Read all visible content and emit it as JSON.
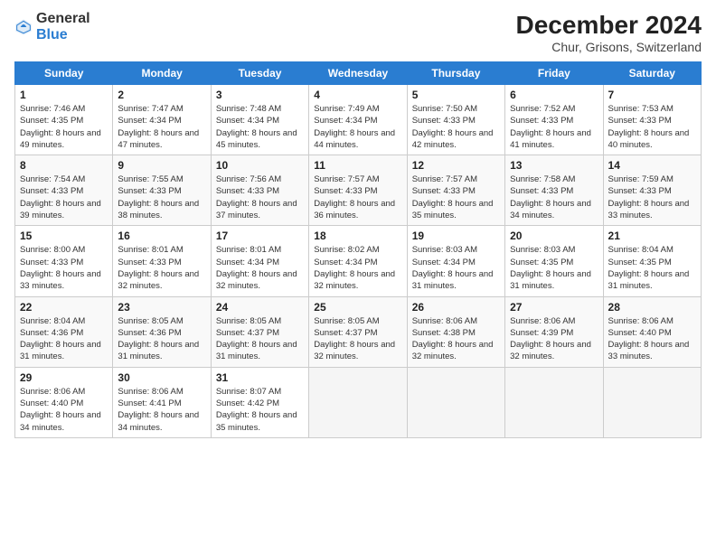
{
  "header": {
    "logo_general": "General",
    "logo_blue": "Blue",
    "main_title": "December 2024",
    "subtitle": "Chur, Grisons, Switzerland"
  },
  "columns": [
    "Sunday",
    "Monday",
    "Tuesday",
    "Wednesday",
    "Thursday",
    "Friday",
    "Saturday"
  ],
  "weeks": [
    [
      {
        "day": "1",
        "sunrise": "Sunrise: 7:46 AM",
        "sunset": "Sunset: 4:35 PM",
        "daylight": "Daylight: 8 hours and 49 minutes."
      },
      {
        "day": "2",
        "sunrise": "Sunrise: 7:47 AM",
        "sunset": "Sunset: 4:34 PM",
        "daylight": "Daylight: 8 hours and 47 minutes."
      },
      {
        "day": "3",
        "sunrise": "Sunrise: 7:48 AM",
        "sunset": "Sunset: 4:34 PM",
        "daylight": "Daylight: 8 hours and 45 minutes."
      },
      {
        "day": "4",
        "sunrise": "Sunrise: 7:49 AM",
        "sunset": "Sunset: 4:34 PM",
        "daylight": "Daylight: 8 hours and 44 minutes."
      },
      {
        "day": "5",
        "sunrise": "Sunrise: 7:50 AM",
        "sunset": "Sunset: 4:33 PM",
        "daylight": "Daylight: 8 hours and 42 minutes."
      },
      {
        "day": "6",
        "sunrise": "Sunrise: 7:52 AM",
        "sunset": "Sunset: 4:33 PM",
        "daylight": "Daylight: 8 hours and 41 minutes."
      },
      {
        "day": "7",
        "sunrise": "Sunrise: 7:53 AM",
        "sunset": "Sunset: 4:33 PM",
        "daylight": "Daylight: 8 hours and 40 minutes."
      }
    ],
    [
      {
        "day": "8",
        "sunrise": "Sunrise: 7:54 AM",
        "sunset": "Sunset: 4:33 PM",
        "daylight": "Daylight: 8 hours and 39 minutes."
      },
      {
        "day": "9",
        "sunrise": "Sunrise: 7:55 AM",
        "sunset": "Sunset: 4:33 PM",
        "daylight": "Daylight: 8 hours and 38 minutes."
      },
      {
        "day": "10",
        "sunrise": "Sunrise: 7:56 AM",
        "sunset": "Sunset: 4:33 PM",
        "daylight": "Daylight: 8 hours and 37 minutes."
      },
      {
        "day": "11",
        "sunrise": "Sunrise: 7:57 AM",
        "sunset": "Sunset: 4:33 PM",
        "daylight": "Daylight: 8 hours and 36 minutes."
      },
      {
        "day": "12",
        "sunrise": "Sunrise: 7:57 AM",
        "sunset": "Sunset: 4:33 PM",
        "daylight": "Daylight: 8 hours and 35 minutes."
      },
      {
        "day": "13",
        "sunrise": "Sunrise: 7:58 AM",
        "sunset": "Sunset: 4:33 PM",
        "daylight": "Daylight: 8 hours and 34 minutes."
      },
      {
        "day": "14",
        "sunrise": "Sunrise: 7:59 AM",
        "sunset": "Sunset: 4:33 PM",
        "daylight": "Daylight: 8 hours and 33 minutes."
      }
    ],
    [
      {
        "day": "15",
        "sunrise": "Sunrise: 8:00 AM",
        "sunset": "Sunset: 4:33 PM",
        "daylight": "Daylight: 8 hours and 33 minutes."
      },
      {
        "day": "16",
        "sunrise": "Sunrise: 8:01 AM",
        "sunset": "Sunset: 4:33 PM",
        "daylight": "Daylight: 8 hours and 32 minutes."
      },
      {
        "day": "17",
        "sunrise": "Sunrise: 8:01 AM",
        "sunset": "Sunset: 4:34 PM",
        "daylight": "Daylight: 8 hours and 32 minutes."
      },
      {
        "day": "18",
        "sunrise": "Sunrise: 8:02 AM",
        "sunset": "Sunset: 4:34 PM",
        "daylight": "Daylight: 8 hours and 32 minutes."
      },
      {
        "day": "19",
        "sunrise": "Sunrise: 8:03 AM",
        "sunset": "Sunset: 4:34 PM",
        "daylight": "Daylight: 8 hours and 31 minutes."
      },
      {
        "day": "20",
        "sunrise": "Sunrise: 8:03 AM",
        "sunset": "Sunset: 4:35 PM",
        "daylight": "Daylight: 8 hours and 31 minutes."
      },
      {
        "day": "21",
        "sunrise": "Sunrise: 8:04 AM",
        "sunset": "Sunset: 4:35 PM",
        "daylight": "Daylight: 8 hours and 31 minutes."
      }
    ],
    [
      {
        "day": "22",
        "sunrise": "Sunrise: 8:04 AM",
        "sunset": "Sunset: 4:36 PM",
        "daylight": "Daylight: 8 hours and 31 minutes."
      },
      {
        "day": "23",
        "sunrise": "Sunrise: 8:05 AM",
        "sunset": "Sunset: 4:36 PM",
        "daylight": "Daylight: 8 hours and 31 minutes."
      },
      {
        "day": "24",
        "sunrise": "Sunrise: 8:05 AM",
        "sunset": "Sunset: 4:37 PM",
        "daylight": "Daylight: 8 hours and 31 minutes."
      },
      {
        "day": "25",
        "sunrise": "Sunrise: 8:05 AM",
        "sunset": "Sunset: 4:37 PM",
        "daylight": "Daylight: 8 hours and 32 minutes."
      },
      {
        "day": "26",
        "sunrise": "Sunrise: 8:06 AM",
        "sunset": "Sunset: 4:38 PM",
        "daylight": "Daylight: 8 hours and 32 minutes."
      },
      {
        "day": "27",
        "sunrise": "Sunrise: 8:06 AM",
        "sunset": "Sunset: 4:39 PM",
        "daylight": "Daylight: 8 hours and 32 minutes."
      },
      {
        "day": "28",
        "sunrise": "Sunrise: 8:06 AM",
        "sunset": "Sunset: 4:40 PM",
        "daylight": "Daylight: 8 hours and 33 minutes."
      }
    ],
    [
      {
        "day": "29",
        "sunrise": "Sunrise: 8:06 AM",
        "sunset": "Sunset: 4:40 PM",
        "daylight": "Daylight: 8 hours and 34 minutes."
      },
      {
        "day": "30",
        "sunrise": "Sunrise: 8:06 AM",
        "sunset": "Sunset: 4:41 PM",
        "daylight": "Daylight: 8 hours and 34 minutes."
      },
      {
        "day": "31",
        "sunrise": "Sunrise: 8:07 AM",
        "sunset": "Sunset: 4:42 PM",
        "daylight": "Daylight: 8 hours and 35 minutes."
      },
      null,
      null,
      null,
      null
    ]
  ]
}
